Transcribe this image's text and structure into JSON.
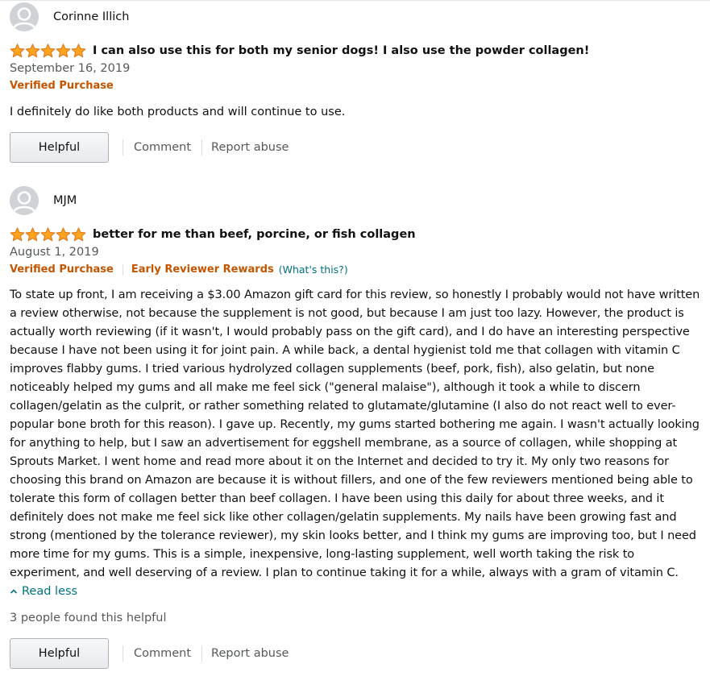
{
  "colors": {
    "star": "#ffa41c",
    "star_stroke": "#de7921",
    "verified": "#c45500",
    "link": "#007185",
    "muted": "#565959"
  },
  "reviews": [
    {
      "reviewer_name": "Corinne Illich",
      "rating": 5,
      "title": "I can also use this for both my senior dogs! I also use the powder collagen!",
      "date": "September 16, 2019",
      "verified_label": "Verified Purchase",
      "body": "I definitely do like both products and will continue to use.",
      "helpful_label": "Helpful",
      "comment_label": "Comment",
      "report_label": "Report abuse"
    },
    {
      "reviewer_name": "MJM",
      "rating": 5,
      "title": "better for me than beef, porcine, or fish collagen",
      "date": "August 1, 2019",
      "verified_label": "Verified Purchase",
      "early_reviewer_label": "Early Reviewer Rewards",
      "whats_this_label": "(What's this?)",
      "body": "To state up front, I am receiving a $3.00 Amazon gift card for this review, so honestly I probably would not have written a review otherwise, not because the supplement is not good, but because I am just too lazy. However, the product is actually worth reviewing (if it wasn't, I would probably pass on the gift card), and I do have an interesting perspective because I have not been using it for joint pain. A while back, a dental hygienist told me that collagen with vitamin C improves flabby gums. I tried various hydrolyzed collagen supplements (beef, pork, fish), also gelatin, but none noticeably helped my gums and all make me feel sick (\"general malaise\"), although it took a while to discern collagen/gelatin as the culprit, or rather something related to glutamate/glutamine (I also do not react well to ever-popular bone broth for this reason). I gave up. Recently, my gums started bothering me again. I wasn't actually looking for anything to help, but I saw an advertisement for eggshell membrane, as a source of collagen, while shopping at Sprouts Market. I went home and read more about it on the Internet and decided to try it. My only two reasons for choosing this brand on Amazon are because it is without fillers, and one of the few reviewers mentioned being able to tolerate this form of collagen better than beef collagen. I have been using this daily for about three weeks, and it definitely does not make me feel sick like other collagen/gelatin supplements. My nails have been growing fast and strong (mentioned by the tolerance reviewer), my skin looks better, and I think my gums are improving too, but I need more time for my gums. This is a simple, inexpensive, long-lasting supplement, well worth taking the risk to experiment, and well deserving of a review. I plan to continue taking it for a while, always with a gram of vitamin C.",
      "read_less_label": "Read less",
      "helpful_count_text": "3 people found this helpful",
      "helpful_label": "Helpful",
      "comment_label": "Comment",
      "report_label": "Report abuse"
    }
  ]
}
